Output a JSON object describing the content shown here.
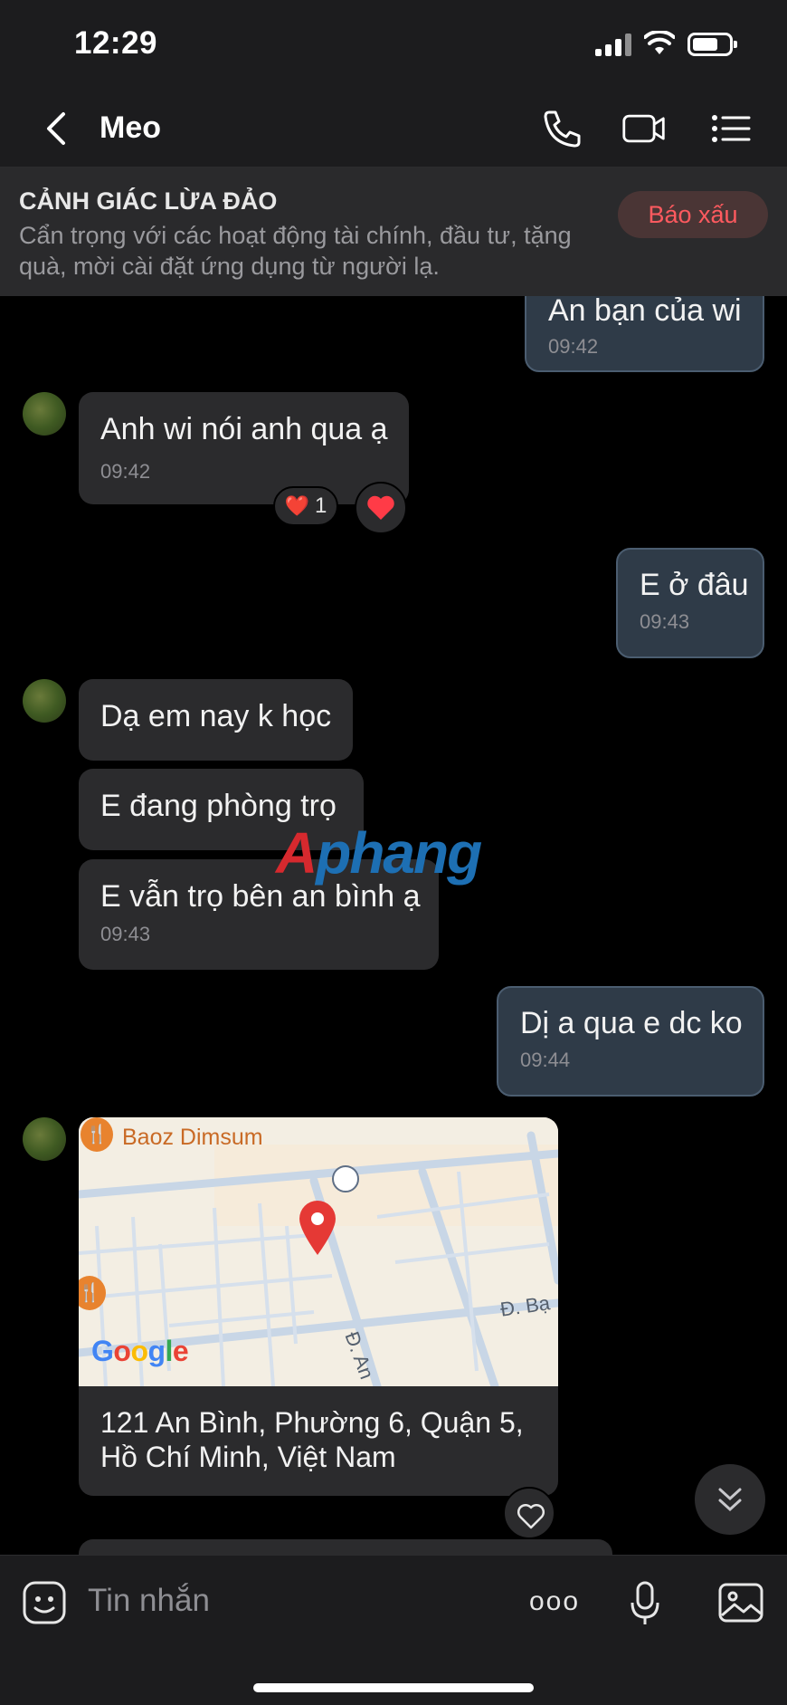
{
  "status_bar": {
    "time": "12:29",
    "battery_level": 0.72
  },
  "header": {
    "contact_name": "Meo",
    "icons": [
      "back-icon",
      "phone-icon",
      "video-icon",
      "menu-icon"
    ]
  },
  "banner": {
    "title": "CẢNH GIÁC LỪA ĐẢO",
    "text": "Cẩn trọng với các hoạt động tài chính, đầu tư, tặng quà, mời cài đặt ứng dụng từ người lạ.",
    "report_label": "Báo xấu"
  },
  "messages": [
    {
      "from": "me",
      "text": "An bạn của wi",
      "time": "09:42"
    },
    {
      "from": "them",
      "text": "Anh wi nói anh qua ạ",
      "time": "09:42",
      "reaction": "❤️",
      "reaction_count": "1"
    },
    {
      "from": "me",
      "text": "E ở đâu",
      "time": "09:43"
    },
    {
      "from": "them",
      "text": "Dạ em nay k học"
    },
    {
      "from": "them",
      "text": "E đang phòng trọ"
    },
    {
      "from": "them",
      "text": "E vẫn trọ bên an bình ạ",
      "time": "09:43"
    },
    {
      "from": "me",
      "text": "Dị a qua e dc ko",
      "time": "09:44"
    }
  ],
  "location": {
    "poi": "Baoz Dimsum",
    "street_1": "Đ. Bạ",
    "street_2": "Đ. An",
    "map_brand": "Google",
    "address_line1": "121 An Bình, Phường 6, Quận 5,",
    "address_line2": "Hồ Chí Minh, Việt Nam"
  },
  "watermark": {
    "part1": "A",
    "part2": "phang"
  },
  "input_bar": {
    "placeholder": "Tin nhắn",
    "more_label": "ooo"
  },
  "colors": {
    "outgoing_bubble": "#2f3b48",
    "incoming_bubble": "#2b2b2d",
    "report_text": "#ff5a5f",
    "accent_blue": "#1d6fb3"
  }
}
